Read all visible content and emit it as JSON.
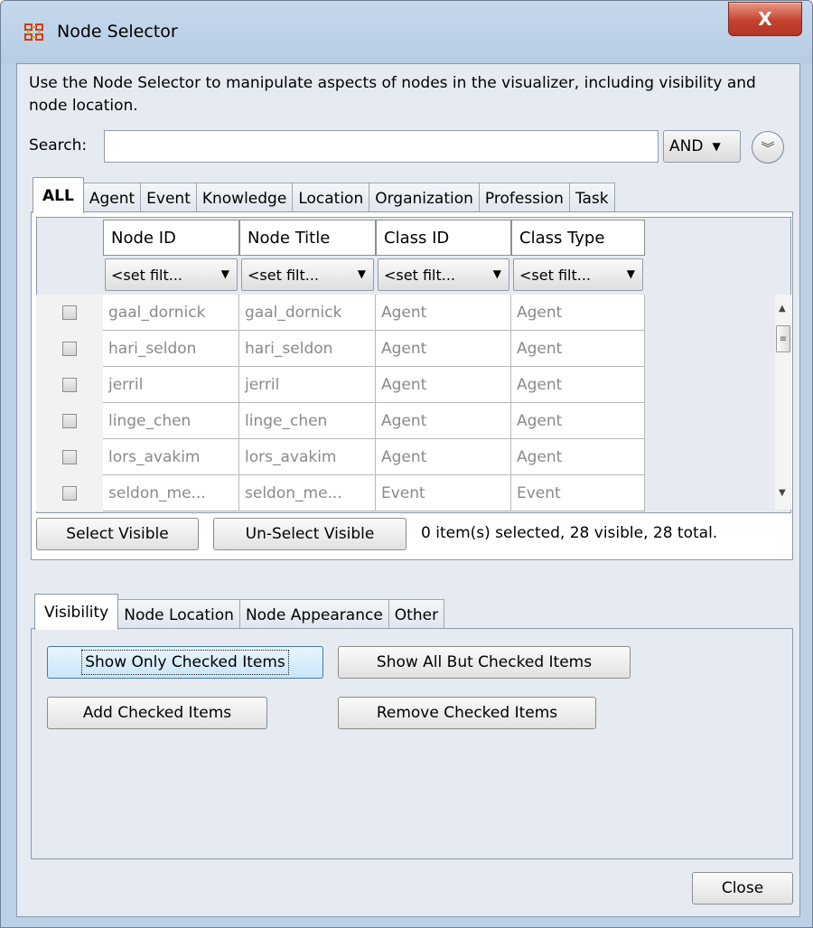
{
  "window": {
    "title": "Node Selector",
    "close_glyph": "X"
  },
  "description": "Use the Node Selector to manipulate aspects of nodes in the visualizer, including visibility and node location.",
  "search": {
    "label": "Search:",
    "value": "",
    "mode": "AND"
  },
  "node_tabs": [
    "ALL",
    "Agent",
    "Event",
    "Knowledge",
    "Location",
    "Organization",
    "Profession",
    "Task"
  ],
  "active_node_tab": "ALL",
  "table": {
    "columns": [
      "Node ID",
      "Node Title",
      "Class ID",
      "Class Type"
    ],
    "filter_label": "<set filt...",
    "rows": [
      [
        "gaal_dornick",
        "gaal_dornick",
        "Agent",
        "Agent"
      ],
      [
        "hari_seldon",
        "hari_seldon",
        "Agent",
        "Agent"
      ],
      [
        "jerril",
        "jerril",
        "Agent",
        "Agent"
      ],
      [
        "linge_chen",
        "linge_chen",
        "Agent",
        "Agent"
      ],
      [
        "lors_avakim",
        "lors_avakim",
        "Agent",
        "Agent"
      ],
      [
        "seldon_me...",
        "seldon_me...",
        "Event",
        "Event"
      ]
    ]
  },
  "selection": {
    "select_visible": "Select Visible",
    "unselect_visible": "Un-Select Visible",
    "status": "0 item(s) selected, 28 visible, 28 total."
  },
  "action_tabs": [
    "Visibility",
    "Node Location",
    "Node Appearance",
    "Other"
  ],
  "active_action_tab": "Visibility",
  "visibility": {
    "show_only_checked": "Show Only Checked Items",
    "show_all_but_checked": "Show All But Checked Items",
    "add_checked": "Add Checked Items",
    "remove_checked": "Remove Checked Items"
  },
  "footer": {
    "close": "Close"
  },
  "colors": {
    "title_bar": "#bcd0e6",
    "client": "#e6ebf2",
    "close_x": "#c5422f",
    "focused_button": "#c9e6f9"
  },
  "icons": {
    "app": "network-nodes-icon",
    "expand": "double-chevron-down-icon",
    "dropdown": "caret-down-icon"
  }
}
